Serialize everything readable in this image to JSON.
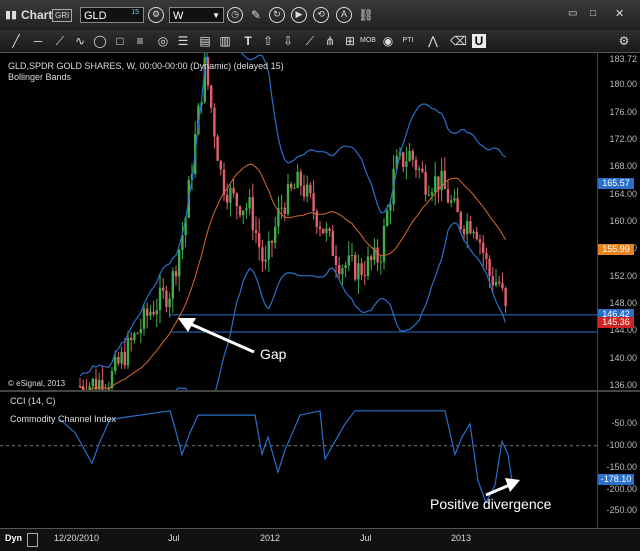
{
  "window": {
    "title": "Chart",
    "tag": "GRI"
  },
  "symbol_field": {
    "value": "GLD",
    "sup": "15"
  },
  "interval_field": {
    "value": "W"
  },
  "toolbar_icons": [
    "line-icon",
    "hline-icon",
    "draw-icon",
    "wave-icon",
    "ellipse-icon",
    "rect-icon",
    "fib-icon",
    "target-icon",
    "grid-icon",
    "bars-icon",
    "text-icon",
    "up-arrow-icon",
    "down-arrow-icon",
    "fan-icon",
    "pitchfork-icon",
    "mob-icon",
    "eye-icon",
    "pti-icon",
    "wave2-icon",
    "eraser-icon",
    "u-icon"
  ],
  "toolbar_labels": {
    "mob": "MOB",
    "pti": "PTI"
  },
  "price_panel": {
    "symbol_line": "GLD,SPDR GOLD SHARES, W, 00:00-00:00 (Dynamic) (delayed 15)",
    "study_name": "Bollinger Bands",
    "copyright": "© eSignal, 2013",
    "ticks": [
      "183.72",
      "180.00",
      "176.00",
      "172.00",
      "168.00",
      "164.00",
      "160.00",
      "156.00",
      "152.00",
      "148.00",
      "144.00",
      "140.00",
      "136.00"
    ],
    "badges": [
      {
        "label": "165.57",
        "color": "#2a6fc9",
        "value": 165.57
      },
      {
        "label": "155.99",
        "color": "#e8821a",
        "value": 155.99
      },
      {
        "label": "146.42",
        "color": "#2a6fc9",
        "value": 146.42
      },
      {
        "label": "145.36",
        "color": "#d02424",
        "value": 145.36
      }
    ]
  },
  "cci_panel": {
    "title": "CCI (14, C)",
    "subtitle": "Commodity Channel Index",
    "ticks": [
      "-50.00",
      "-100.00",
      "-150.00",
      "-200.00",
      "-250.00"
    ],
    "badge": {
      "label": "-178.10",
      "color": "#2a6fc9",
      "value": -178.1
    }
  },
  "date_axis": {
    "left_tag": "Dyn",
    "labels": [
      "12/20/2010",
      "Jul",
      "2012",
      "Jul",
      "2013"
    ]
  },
  "annotations": {
    "gap": "Gap",
    "divergence": "Positive divergence"
  },
  "colors": {
    "up": "#3fae49",
    "down": "#e0606e",
    "band": "#2a6fc9",
    "mid": "#d86a2a",
    "background": "#000000"
  }
}
